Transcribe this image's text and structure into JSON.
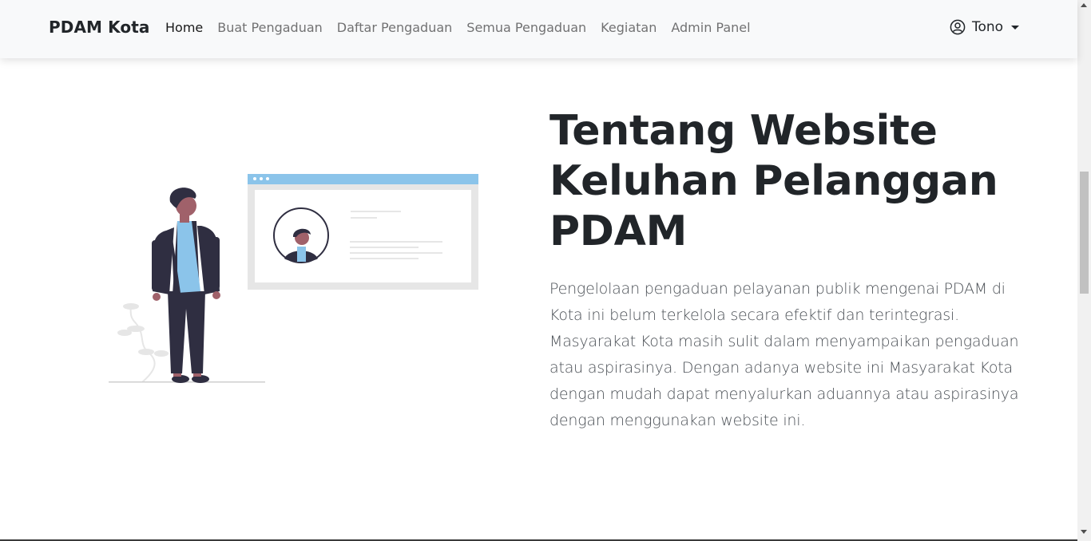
{
  "navbar": {
    "brand": "PDAM Kota",
    "links": [
      {
        "label": "Home",
        "active": true
      },
      {
        "label": "Buat Pengaduan"
      },
      {
        "label": "Daftar Pengaduan"
      },
      {
        "label": "Semua Pengaduan"
      },
      {
        "label": "Kegiatan"
      },
      {
        "label": "Admin Panel"
      }
    ],
    "user": {
      "name": "Tono",
      "icon": "user-circle-icon"
    }
  },
  "hero": {
    "title": "Tentang Website Keluhan Pelanggan PDAM",
    "description": "Pengelolaan pengaduan pelayanan publik mengenai PDAM di Kota ini belum terkelola secara efektif dan terintegrasi. Masyarakat Kota masih sulit dalam menyampaikan pengaduan atau aspirasinya. Dengan adanya website ini Masyarakat Kota dengan mudah dapat menyalurkan aduannya atau aspirasinya dengan menggunakan website ini."
  },
  "colors": {
    "navbar_bg": "#f8f9fa",
    "accent_blue": "#8bc4ea",
    "skin": "#a0616a",
    "dark": "#2f2e41"
  }
}
